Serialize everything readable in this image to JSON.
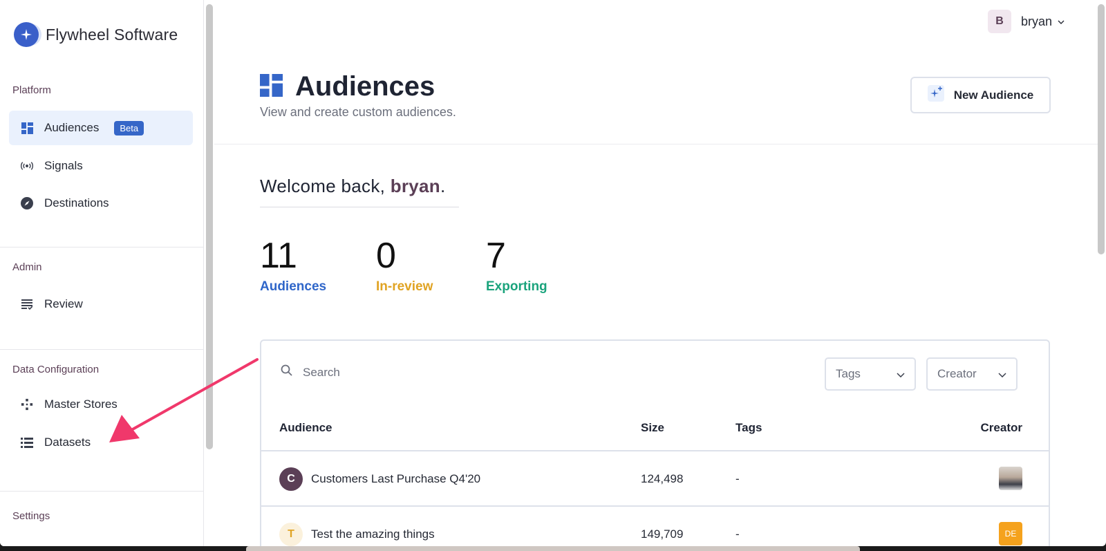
{
  "brand": {
    "name": "Flywheel Software"
  },
  "sidebar": {
    "sections": [
      {
        "label": "Platform"
      },
      {
        "label": "Admin"
      },
      {
        "label": "Data Configuration"
      },
      {
        "label": "Settings"
      }
    ],
    "items": [
      {
        "label": "Audiences",
        "icon": "dashboard-icon",
        "badge": "Beta",
        "active": true
      },
      {
        "label": "Signals",
        "icon": "broadcast-icon"
      },
      {
        "label": "Destinations",
        "icon": "compass-icon"
      },
      {
        "label": "Review",
        "icon": "review-list-icon"
      },
      {
        "label": "Master Stores",
        "icon": "diamond-nodes-icon"
      },
      {
        "label": "Datasets",
        "icon": "stack-list-icon"
      }
    ]
  },
  "user": {
    "initial": "B",
    "name": "bryan"
  },
  "header": {
    "title": "Audiences",
    "subtitle": "View and create custom audiences.",
    "new_button": "New Audience"
  },
  "welcome": {
    "prefix": "Welcome back, ",
    "name": "bryan",
    "suffix": "."
  },
  "stats": [
    {
      "value": "11",
      "label": "Audiences",
      "color": "#2f66c9"
    },
    {
      "value": "0",
      "label": "In-review",
      "color": "#e0a323"
    },
    {
      "value": "7",
      "label": "Exporting",
      "color": "#1aa37c"
    }
  ],
  "filters": {
    "search_placeholder": "Search",
    "tags_label": "Tags",
    "creator_label": "Creator"
  },
  "table": {
    "columns": [
      "Audience",
      "Size",
      "Tags",
      "Creator"
    ],
    "rows": [
      {
        "initial": "C",
        "name": "Customers Last Purchase Q4'20",
        "size": "124,498",
        "tags": "-",
        "creator": "photo"
      },
      {
        "initial": "T",
        "name": "Test the amazing things",
        "size": "149,709",
        "tags": "-",
        "creator": "DE"
      }
    ]
  },
  "colors": {
    "accent": "#3566c8",
    "brand_purple": "#5b3f56",
    "annotation": "#f0386b"
  }
}
